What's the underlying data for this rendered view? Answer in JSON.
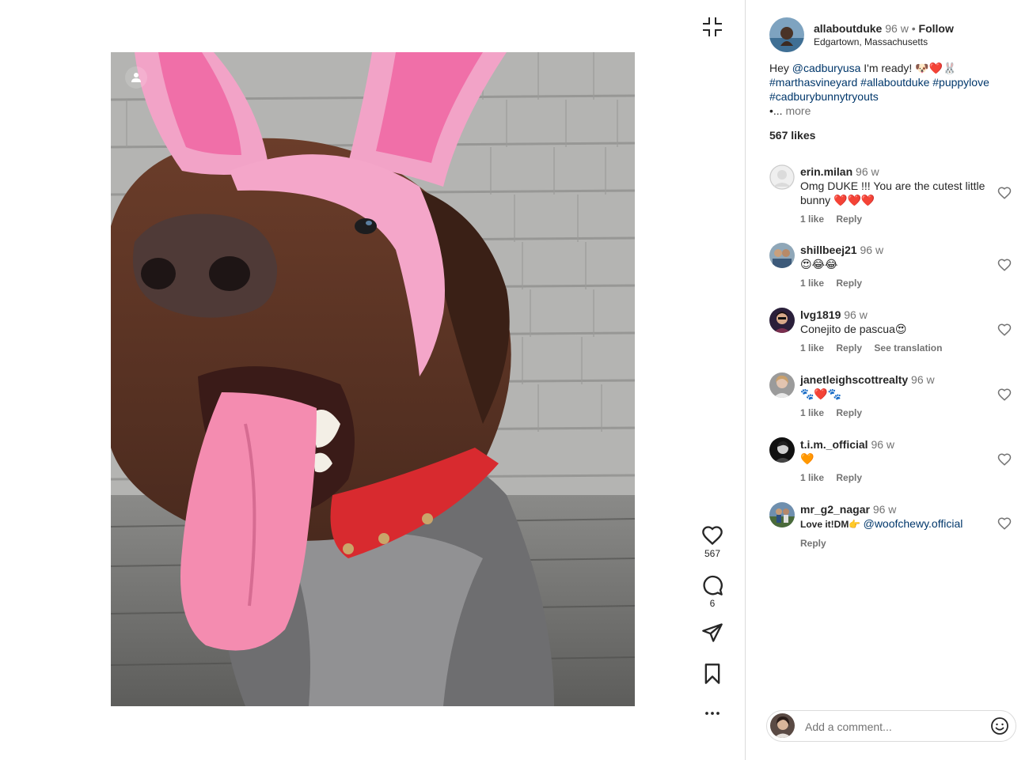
{
  "post": {
    "author": "allaboutduke",
    "time": "96 w",
    "separator": "•",
    "follow_label": "Follow",
    "location": "Edgartown, Massachusetts",
    "caption": {
      "text_1": "Hey ",
      "mention": "@cadburyusa",
      "text_2": " I'm ready! 🐶❤️🐰",
      "hashtag_1": "#marthasvineyard",
      "hashtag_2": "#allaboutduke",
      "hashtag_3": "#puppylove",
      "hashtag_4": "#cadburybunnytryouts",
      "ellipsis": "•...",
      "more_label": "more"
    },
    "likes_label": "567 likes"
  },
  "actions": {
    "like_count": "567",
    "comment_count": "6"
  },
  "comments": [
    {
      "user": "erin.milan",
      "time": "96 w",
      "text": "Omg DUKE !!! You are the cutest little bunny ❤️❤️❤️",
      "likes": "1 like",
      "reply": "Reply"
    },
    {
      "user": "shillbeej21",
      "time": "96 w",
      "text": "😍😂😂",
      "likes": "1 like",
      "reply": "Reply"
    },
    {
      "user": "lvg1819",
      "time": "96 w",
      "text": "Conejito de pascua😍",
      "likes": "1 like",
      "reply": "Reply",
      "translate": "See translation"
    },
    {
      "user": "janetleighscottrealty",
      "time": "96 w",
      "text": "🐾❤️🐾",
      "likes": "1 like",
      "reply": "Reply"
    },
    {
      "user": "t.i.m._official",
      "time": "96 w",
      "text": "🧡",
      "likes": "1 like",
      "reply": "Reply"
    },
    {
      "user": "mr_g2_nagar",
      "time": "96 w",
      "text": "Love it!DM👉 ",
      "mention": "@woofchewy.official",
      "reply": "Reply"
    }
  ],
  "composer": {
    "placeholder": "Add a comment..."
  },
  "icons": {
    "collapse": "collapse-icon",
    "like": "heart-icon",
    "comment": "comment-bubble-icon",
    "share": "paper-plane-icon",
    "save": "bookmark-icon",
    "more": "more-dots-icon",
    "emoji": "smiley-icon",
    "tag": "user-tag-icon"
  },
  "colors": {
    "link": "#00376b",
    "muted": "#737373",
    "heart_red": "#ed4956",
    "border": "#dbdbdb"
  }
}
